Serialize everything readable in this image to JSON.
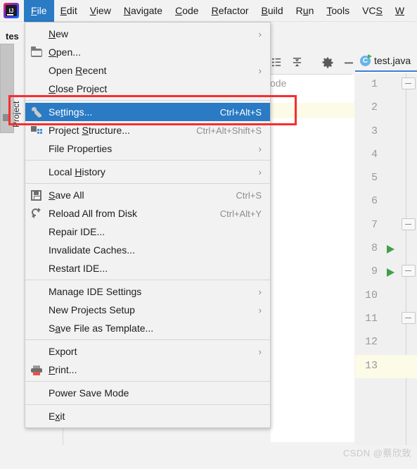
{
  "app": {
    "logo_text": "IJ",
    "project_name": "tes"
  },
  "menubar": {
    "items": [
      {
        "label": "File",
        "mnemonic": "F",
        "active": true
      },
      {
        "label": "Edit",
        "mnemonic": "E",
        "active": false
      },
      {
        "label": "View",
        "mnemonic": "V",
        "active": false
      },
      {
        "label": "Navigate",
        "mnemonic": "N",
        "active": false
      },
      {
        "label": "Code",
        "mnemonic": "C",
        "active": false
      },
      {
        "label": "Refactor",
        "mnemonic": "R",
        "active": false
      },
      {
        "label": "Build",
        "mnemonic": "B",
        "active": false
      },
      {
        "label": "Run",
        "mnemonic": "u",
        "active": false
      },
      {
        "label": "Tools",
        "mnemonic": "T",
        "active": false
      },
      {
        "label": "VCS",
        "mnemonic": "S",
        "active": false
      },
      {
        "label": "W",
        "mnemonic": "W",
        "active": false
      }
    ]
  },
  "file_menu": {
    "items": [
      {
        "label": "New",
        "accel": "",
        "arrow": "›",
        "icon": "",
        "selected": false
      },
      {
        "label": "Open...",
        "accel": "",
        "arrow": "",
        "icon": "folder-icon",
        "selected": false
      },
      {
        "label": "Open Recent",
        "accel": "",
        "arrow": "›",
        "icon": "",
        "selected": false
      },
      {
        "label": "Close Project",
        "accel": "",
        "arrow": "",
        "icon": "",
        "selected": false
      },
      {
        "separator": true
      },
      {
        "label": "Settings...",
        "accel": "Ctrl+Alt+S",
        "arrow": "",
        "icon": "wrench-icon",
        "selected": true
      },
      {
        "label": "Project Structure...",
        "accel": "Ctrl+Alt+Shift+S",
        "arrow": "",
        "icon": "project-structure-icon",
        "selected": false
      },
      {
        "label": "File Properties",
        "accel": "",
        "arrow": "›",
        "icon": "",
        "selected": false
      },
      {
        "separator": true
      },
      {
        "label": "Local History",
        "accel": "",
        "arrow": "›",
        "icon": "",
        "selected": false
      },
      {
        "separator": true
      },
      {
        "label": "Save All",
        "accel": "Ctrl+S",
        "arrow": "",
        "icon": "save-icon",
        "selected": false
      },
      {
        "label": "Reload All from Disk",
        "accel": "Ctrl+Alt+Y",
        "arrow": "",
        "icon": "reload-icon",
        "selected": false
      },
      {
        "label": "Repair IDE...",
        "accel": "",
        "arrow": "",
        "icon": "",
        "selected": false
      },
      {
        "label": "Invalidate Caches...",
        "accel": "",
        "arrow": "",
        "icon": "",
        "selected": false
      },
      {
        "label": "Restart IDE...",
        "accel": "",
        "arrow": "",
        "icon": "",
        "selected": false
      },
      {
        "separator": true
      },
      {
        "label": "Manage IDE Settings",
        "accel": "",
        "arrow": "›",
        "icon": "",
        "selected": false
      },
      {
        "label": "New Projects Setup",
        "accel": "",
        "arrow": "›",
        "icon": "",
        "selected": false
      },
      {
        "label": "Save File as Template...",
        "accel": "",
        "arrow": "",
        "icon": "",
        "selected": false
      },
      {
        "separator": true
      },
      {
        "label": "Export",
        "accel": "",
        "arrow": "›",
        "icon": "",
        "selected": false
      },
      {
        "label": "Print...",
        "accel": "",
        "arrow": "",
        "icon": "print-icon",
        "selected": false
      },
      {
        "separator": true
      },
      {
        "label": "Power Save Mode",
        "accel": "",
        "arrow": "",
        "icon": "",
        "selected": false
      },
      {
        "separator": true
      },
      {
        "label": "Exit",
        "accel": "",
        "arrow": "",
        "icon": "",
        "selected": false
      }
    ]
  },
  "sidebar": {
    "tool_window_label": "Project"
  },
  "toolbar": {
    "icons": [
      "expand-list-icon",
      "collapse-all-icon",
      "gear-icon",
      "minimize-icon"
    ]
  },
  "project_tree": {
    "partial_label": "ode"
  },
  "editor": {
    "tab_label": "test.java",
    "tab_icon": "java-class-icon",
    "current_line": 13,
    "lines": [
      {
        "n": "1",
        "run": false,
        "fold": true
      },
      {
        "n": "2",
        "run": false,
        "fold": false
      },
      {
        "n": "3",
        "run": false,
        "fold": false
      },
      {
        "n": "4",
        "run": false,
        "fold": false
      },
      {
        "n": "5",
        "run": false,
        "fold": false
      },
      {
        "n": "6",
        "run": false,
        "fold": false
      },
      {
        "n": "7",
        "run": false,
        "fold": true
      },
      {
        "n": "8",
        "run": true,
        "fold": false
      },
      {
        "n": "9",
        "run": true,
        "fold": true
      },
      {
        "n": "10",
        "run": false,
        "fold": false
      },
      {
        "n": "11",
        "run": false,
        "fold": true
      },
      {
        "n": "12",
        "run": false,
        "fold": false
      },
      {
        "n": "13",
        "run": false,
        "fold": false
      }
    ]
  },
  "annotation": {
    "highlight_target": "Settings...",
    "color": "#fb2c2c"
  },
  "watermark": {
    "text": "CSDN @蔡欣致"
  },
  "colors": {
    "selection_blue": "#2a7ac4",
    "tab_underline": "#3c7fd4",
    "current_line": "#fcfbe8",
    "panel_bg": "#f2f2f2",
    "run_green": "#40a04a"
  }
}
